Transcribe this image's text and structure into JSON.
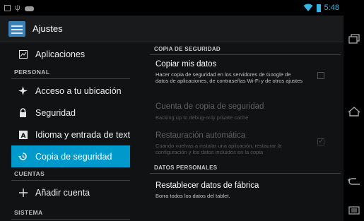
{
  "status_bar": {
    "time": "5:48",
    "left_icons": [
      "screenshot-icon",
      "usb-icon",
      "gamepad-icon"
    ],
    "right_icons": [
      "wifi-icon",
      "battery-icon"
    ],
    "accent_color": "#33b5e5"
  },
  "action_bar": {
    "title": "Ajustes",
    "icon": "settings-app-icon"
  },
  "sidebar": {
    "items": [
      {
        "label": "Aplicaciones",
        "icon": "apps-icon",
        "selected": false
      },
      {
        "header": "PERSONAL"
      },
      {
        "label": "Acceso a tu ubicación",
        "icon": "location-icon",
        "selected": false
      },
      {
        "label": "Seguridad",
        "icon": "lock-icon",
        "selected": false
      },
      {
        "label": "Idioma y entrada de texto",
        "icon": "language-icon",
        "selected": false
      },
      {
        "label": "Copia de seguridad",
        "icon": "backup-icon",
        "selected": true
      },
      {
        "header": "CUENTAS"
      },
      {
        "label": "Añadir cuenta",
        "icon": "add-icon",
        "selected": false
      },
      {
        "header": "SISTEMA"
      }
    ],
    "selected_color": "#0099cc"
  },
  "content": {
    "section_backup": "COPIA DE SEGURIDAD",
    "backup_data": {
      "title": "Copiar mis datos",
      "summary": "Hacer copia de seguridad en los servidores de Google de datos de aplicaciones, de contraseñas Wi-Fi y de otros ajustes",
      "checked": false
    },
    "backup_account": {
      "title": "Cuenta de copia de seguridad",
      "summary": "Backing up to debug-only private cache",
      "enabled": false
    },
    "auto_restore": {
      "title": "Restauración automática",
      "summary": "Cuando vuelvas a instalar una aplicación, restaurar la configuración y los datos incluidos en la copia",
      "checked": true,
      "enabled": false
    },
    "section_personal": "DATOS PERSONALES",
    "factory_reset": {
      "title": "Restablecer datos de fábrica",
      "summary": "Borra todos los datos del tablet."
    }
  },
  "nav_bar": {
    "buttons": [
      "recent-apps-icon",
      "home-icon",
      "back-icon",
      "menu-icon"
    ]
  }
}
